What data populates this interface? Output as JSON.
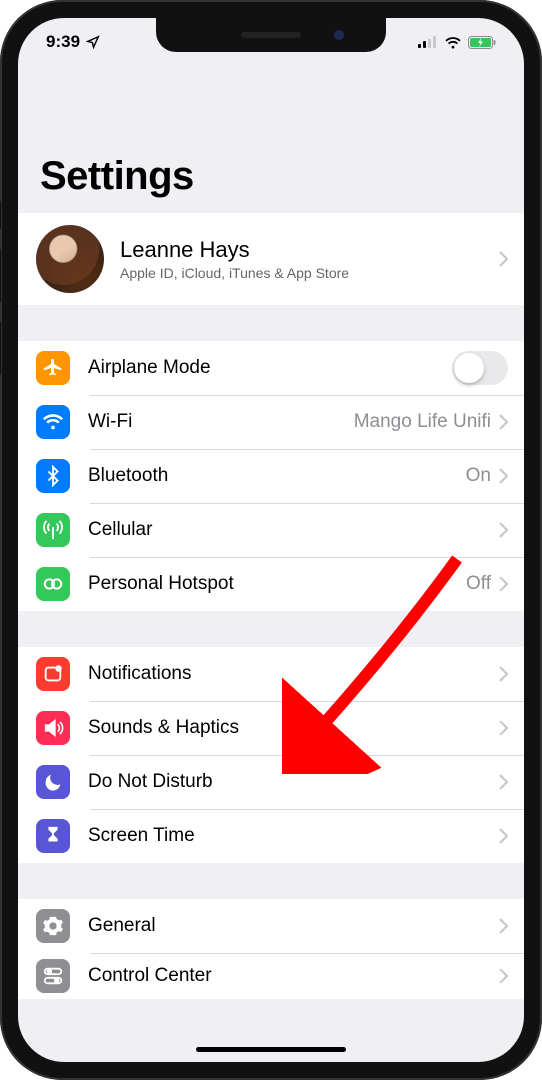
{
  "status": {
    "time": "9:39",
    "location_icon": "location-arrow",
    "cell_bars": 2,
    "wifi": true,
    "battery_charging": true
  },
  "title": "Settings",
  "profile": {
    "name": "Leanne Hays",
    "subtitle": "Apple ID, iCloud, iTunes & App Store"
  },
  "groups": [
    {
      "id": "connectivity",
      "rows": [
        {
          "id": "airplane",
          "icon": "airplane",
          "icon_bg": "#ff9500",
          "label": "Airplane Mode",
          "control": "toggle",
          "toggle_on": false
        },
        {
          "id": "wifi",
          "icon": "wifi",
          "icon_bg": "#007aff",
          "label": "Wi-Fi",
          "value": "Mango Life Unifi",
          "control": "link"
        },
        {
          "id": "bluetooth",
          "icon": "bluetooth",
          "icon_bg": "#007aff",
          "label": "Bluetooth",
          "value": "On",
          "control": "link"
        },
        {
          "id": "cellular",
          "icon": "antenna",
          "icon_bg": "#34c759",
          "label": "Cellular",
          "control": "link"
        },
        {
          "id": "hotspot",
          "icon": "hotspot",
          "icon_bg": "#34c759",
          "label": "Personal Hotspot",
          "value": "Off",
          "control": "link"
        }
      ]
    },
    {
      "id": "notifications",
      "rows": [
        {
          "id": "notifications",
          "icon": "notification",
          "icon_bg": "#ff3b30",
          "label": "Notifications",
          "control": "link"
        },
        {
          "id": "sounds",
          "icon": "speaker",
          "icon_bg": "#ff2d55",
          "label": "Sounds & Haptics",
          "control": "link"
        },
        {
          "id": "dnd",
          "icon": "moon",
          "icon_bg": "#5856d6",
          "label": "Do Not Disturb",
          "control": "link"
        },
        {
          "id": "screentime",
          "icon": "hourglass",
          "icon_bg": "#5856d6",
          "label": "Screen Time",
          "control": "link"
        }
      ]
    },
    {
      "id": "general",
      "rows": [
        {
          "id": "general",
          "icon": "gear",
          "icon_bg": "#8e8e93",
          "label": "General",
          "control": "link"
        },
        {
          "id": "controlcenter",
          "icon": "switches",
          "icon_bg": "#8e8e93",
          "label": "Control Center",
          "control": "link"
        }
      ]
    }
  ],
  "annotation": {
    "type": "arrow",
    "color": "#ff0000",
    "target_row": "sounds"
  }
}
